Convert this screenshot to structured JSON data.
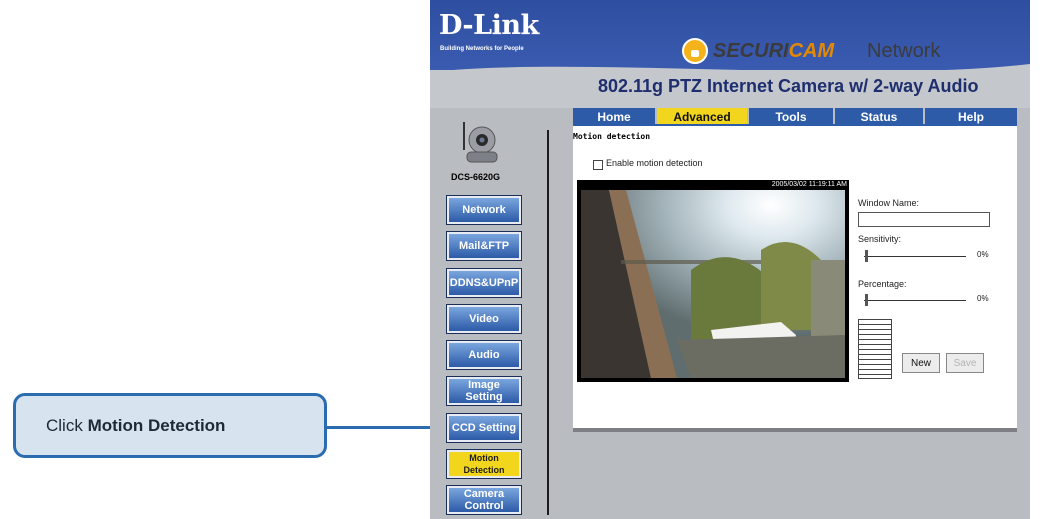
{
  "callout": {
    "prefix": "Click ",
    "emphasis": "Motion Detection"
  },
  "header": {
    "brand": "D-Link",
    "brand_tagline": "Building Networks for People",
    "securicam_part1": "SECURI",
    "securicam_part2": "CAM",
    "network_word": "Network",
    "product": "802.11g PTZ Internet Camera w/ 2-way Audio"
  },
  "camera_model": "DCS-6620G",
  "tabs": [
    {
      "label": "Home"
    },
    {
      "label": "Advanced"
    },
    {
      "label": "Tools"
    },
    {
      "label": "Status"
    },
    {
      "label": "Help"
    }
  ],
  "nav": [
    {
      "label": "Network"
    },
    {
      "label": "Mail&FTP"
    },
    {
      "label": "DDNS&UPnP"
    },
    {
      "label": "Video"
    },
    {
      "label": "Audio"
    },
    {
      "label": "Image Setting"
    },
    {
      "label": "CCD Setting"
    },
    {
      "label": "Motion Detection"
    },
    {
      "label": "Camera Control"
    }
  ],
  "panel": {
    "title": "Motion detection",
    "enable_label": "Enable motion detection",
    "timestamp": "2005/03/02 11:19:11 AM",
    "window_name_label": "Window Name:",
    "window_name_value": "",
    "sensitivity_label": "Sensitivity:",
    "sensitivity_value": "0%",
    "percentage_label": "Percentage:",
    "percentage_value": "0%",
    "new_button": "New",
    "save_button": "Save"
  },
  "colors": {
    "callout_border": "#2b6cb0",
    "callout_fill": "#d7e3ef",
    "tab_blue": "#2d5ba8",
    "active_yellow": "#f2d51d"
  }
}
